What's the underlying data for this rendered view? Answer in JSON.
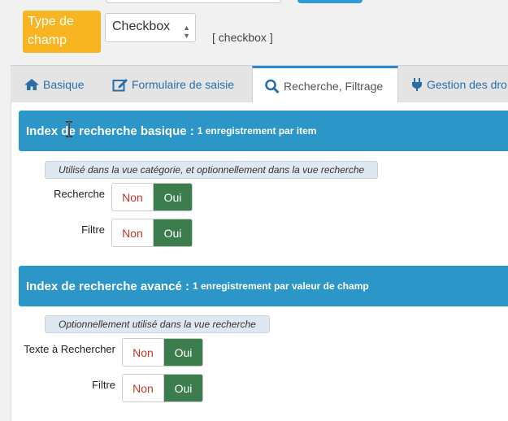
{
  "field_type": {
    "label": "Type de champ",
    "selected": "Checkbox",
    "code": "[ checkbox ]"
  },
  "tabs": [
    {
      "label": "Basique",
      "icon": "home-icon"
    },
    {
      "label": "Formulaire de saisie",
      "icon": "edit-icon"
    },
    {
      "label": "Recherche, Filtrage",
      "icon": "search-icon"
    },
    {
      "label": "Gestion des dro",
      "icon": "plug-icon"
    }
  ],
  "active_tab": "Recherche, Filtrage",
  "basic_index": {
    "title": "Index de recherche basique :",
    "subtitle": "1 enregistrement par item",
    "hint": "Utilisé dans la vue catégorie, et optionnellement dans la vue recherche",
    "rows": [
      {
        "label": "Recherche",
        "no": "Non",
        "yes": "Oui",
        "selected": "Oui"
      },
      {
        "label": "Filtre",
        "no": "Non",
        "yes": "Oui",
        "selected": "Oui"
      }
    ]
  },
  "advanced_index": {
    "title": "Index de recherche avancé :",
    "subtitle": "1 enregistrement par valeur de champ",
    "hint": "Optionnellement utilisé dans la vue recherche",
    "rows": [
      {
        "label": "Texte à Rechercher",
        "no": "Non",
        "yes": "Oui",
        "selected": "Oui"
      },
      {
        "label": "Filtre",
        "no": "Non",
        "yes": "Oui",
        "selected": "Oui"
      }
    ]
  },
  "colors": {
    "accent": "#2d96c8",
    "label_orange": "#f8b521",
    "yes_green": "#3c7d4e",
    "no_red": "#c0392b"
  }
}
